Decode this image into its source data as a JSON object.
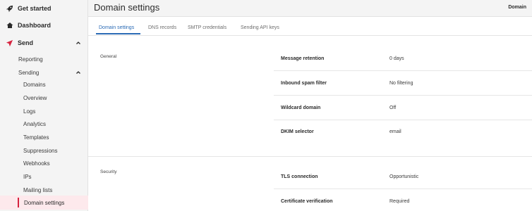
{
  "sidebar": {
    "items": [
      {
        "label": "Get started",
        "icon": "rocket-icon"
      },
      {
        "label": "Dashboard",
        "icon": "home-icon"
      },
      {
        "label": "Send",
        "icon": "send-icon"
      }
    ],
    "send_children": [
      {
        "label": "Reporting"
      },
      {
        "label": "Sending"
      }
    ],
    "sending_children": [
      {
        "label": "Domains"
      },
      {
        "label": "Overview"
      },
      {
        "label": "Logs"
      },
      {
        "label": "Analytics"
      },
      {
        "label": "Templates"
      },
      {
        "label": "Suppressions"
      },
      {
        "label": "Webhooks"
      },
      {
        "label": "IPs"
      },
      {
        "label": "Mailing lists"
      },
      {
        "label": "Domain settings"
      }
    ]
  },
  "header": {
    "title": "Domain settings",
    "right_label": "Domain"
  },
  "tabs": [
    {
      "label": "Domain settings",
      "active": true
    },
    {
      "label": "DNS records",
      "active": false
    },
    {
      "label": "SMTP credentials",
      "active": false
    },
    {
      "label": "Sending API keys",
      "active": false
    }
  ],
  "sections": {
    "general": {
      "label": "General",
      "rows": [
        {
          "label": "Message retention",
          "value": "0 days"
        },
        {
          "label": "Inbound spam filter",
          "value": "No filtering"
        },
        {
          "label": "Wildcard domain",
          "value": "Off"
        },
        {
          "label": "DKIM selector",
          "value": "email"
        }
      ]
    },
    "security": {
      "label": "Security",
      "rows": [
        {
          "label": "TLS connection",
          "value": "Opportunistic"
        },
        {
          "label": "Certificate verification",
          "value": "Required"
        }
      ]
    }
  },
  "colors": {
    "accent": "#2b6bb5",
    "active_highlight": "#fde9ec",
    "active_marker": "#d6233f",
    "send_icon": "#d6233f"
  }
}
